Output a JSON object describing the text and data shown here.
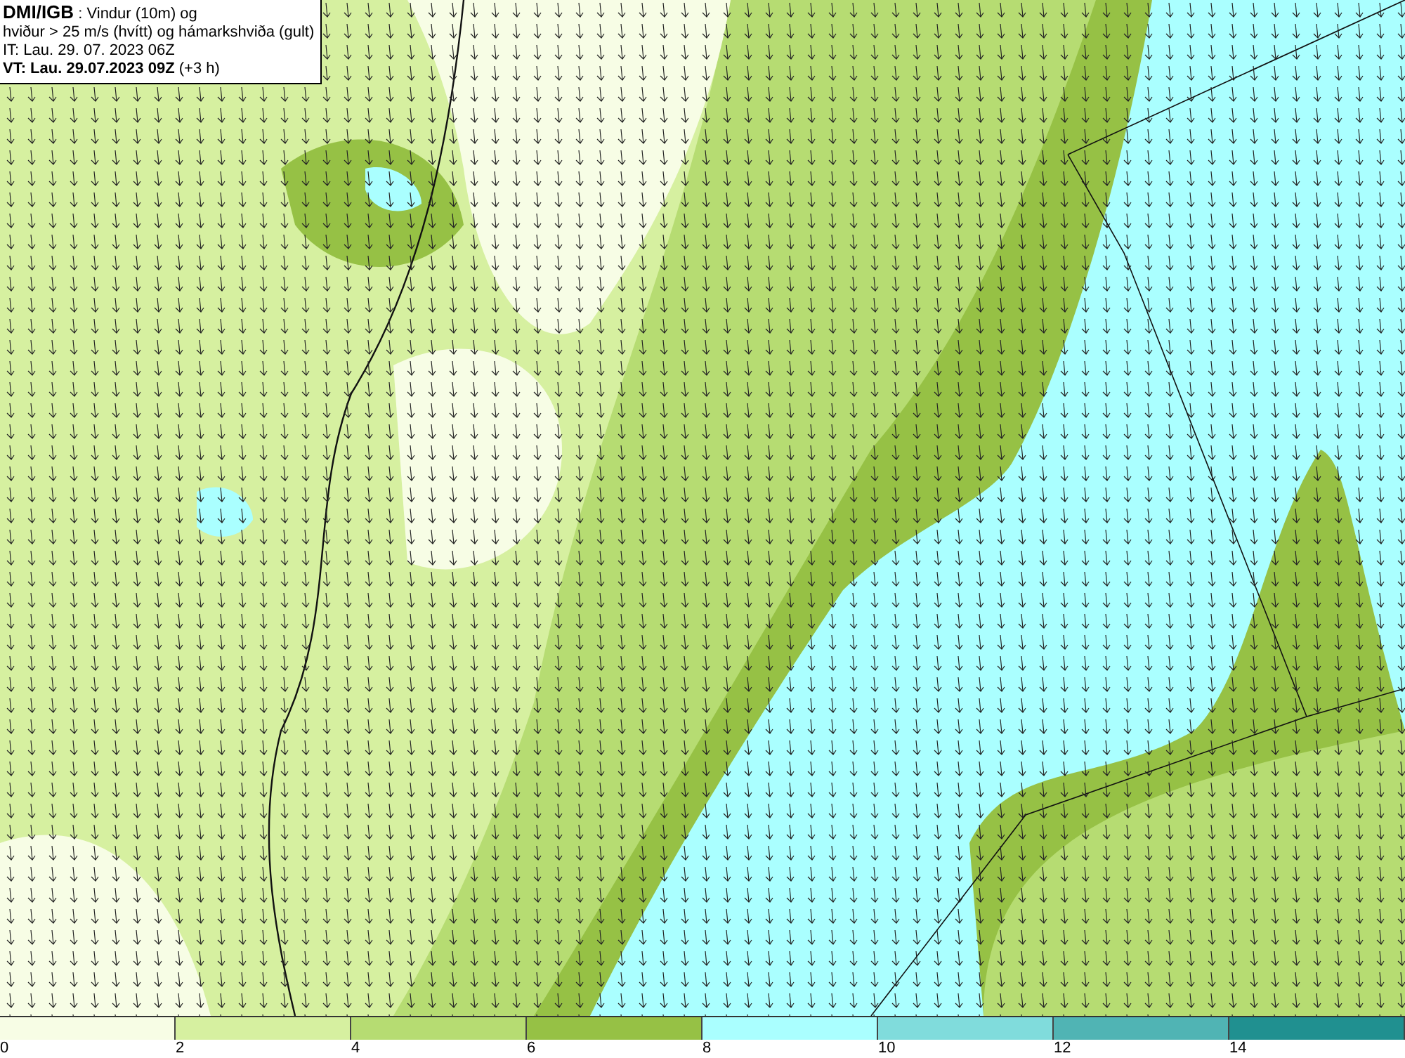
{
  "title_box": {
    "lines": [
      "**DMI/IGB** : Vindur (10m) og",
      "hviður > 25 m/s (hvítt) og hámarkshviða (gult)",
      "IT: Lau. 29. 07. 2023 06Z",
      "**VT: Lau. 29.07.2023 09Z** (+3 h)"
    ]
  },
  "legend": {
    "bins": [
      {
        "label": "0",
        "color": "#f7fde5"
      },
      {
        "label": "2",
        "color": "#d6f0a0"
      },
      {
        "label": "4",
        "color": "#b6dc72"
      },
      {
        "label": "6",
        "color": "#96c145"
      },
      {
        "label": "8",
        "color": "#aaffff"
      },
      {
        "label": "10",
        "color": "#80dcdc"
      },
      {
        "label": "12",
        "color": "#50b4b4"
      },
      {
        "label": "14",
        "color": "#209090"
      }
    ]
  }
}
